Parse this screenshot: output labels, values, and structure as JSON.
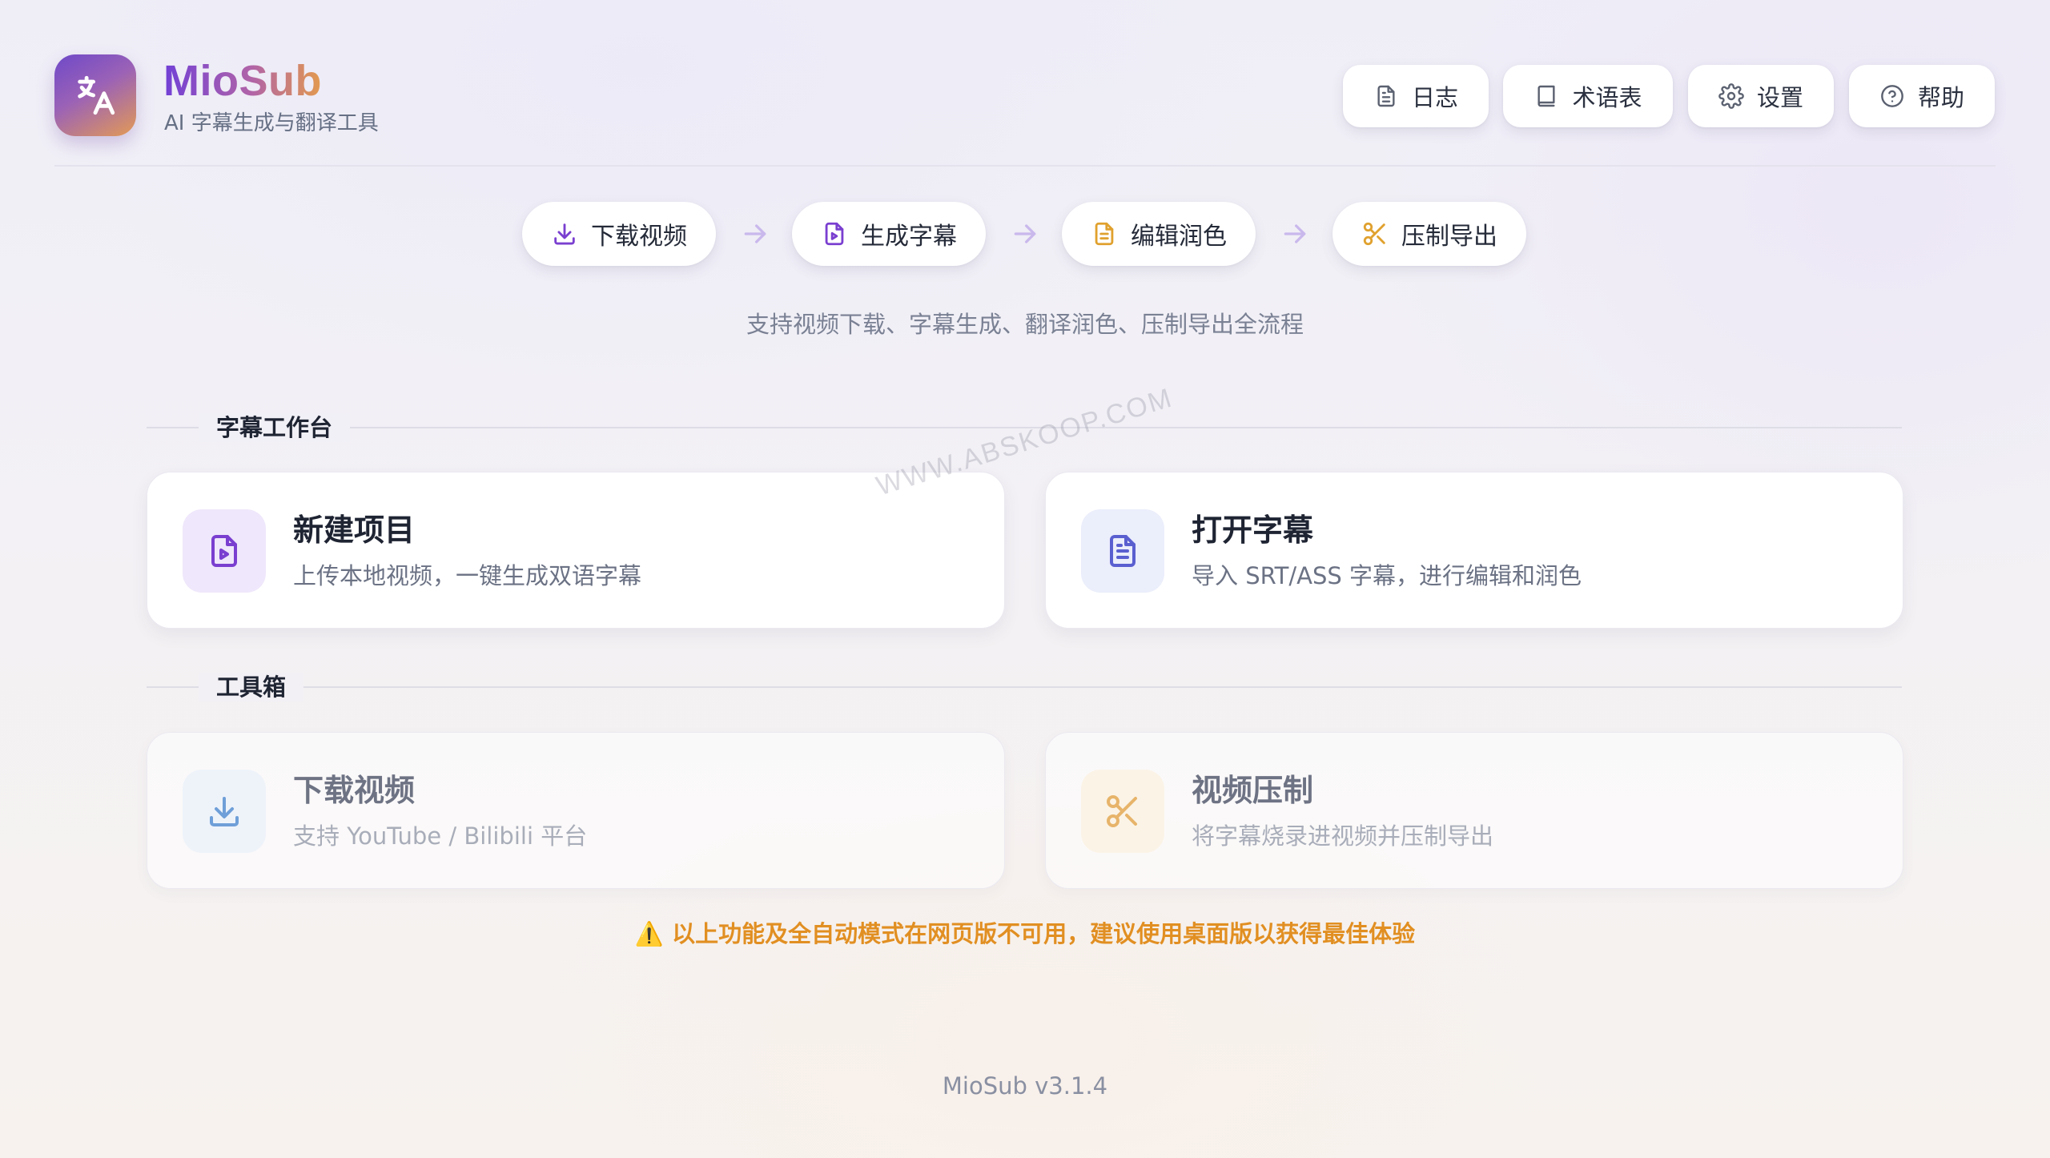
{
  "header": {
    "app_title": "MioSub",
    "app_subtitle": "AI 字幕生成与翻译工具",
    "buttons": [
      {
        "label": "日志",
        "icon": "document-icon"
      },
      {
        "label": "术语表",
        "icon": "book-icon"
      },
      {
        "label": "设置",
        "icon": "gear-icon"
      },
      {
        "label": "帮助",
        "icon": "help-circle-icon"
      }
    ]
  },
  "steps": [
    {
      "label": "下载视频",
      "icon": "download-icon",
      "color": "#7a3fd0"
    },
    {
      "label": "生成字幕",
      "icon": "video-file-icon",
      "color": "#7a3fd0"
    },
    {
      "label": "编辑润色",
      "icon": "text-file-icon",
      "color": "#e0a12e"
    },
    {
      "label": "压制导出",
      "icon": "scissors-icon",
      "color": "#e0a12e"
    }
  ],
  "tagline": "支持视频下载、字幕生成、翻译润色、压制导出全流程",
  "sections": {
    "workbench": {
      "title": "字幕工作台",
      "cards": [
        {
          "title": "新建项目",
          "desc": "上传本地视频，一键生成双语字幕",
          "icon": "video-file-icon"
        },
        {
          "title": "打开字幕",
          "desc": "导入 SRT/ASS 字幕，进行编辑和润色",
          "icon": "text-file-icon"
        }
      ]
    },
    "toolbox": {
      "title": "工具箱",
      "cards": [
        {
          "title": "下载视频",
          "desc": "支持 YouTube / Bilibili 平台",
          "icon": "download-icon"
        },
        {
          "title": "视频压制",
          "desc": "将字幕烧录进视频并压制导出",
          "icon": "scissors-icon"
        }
      ]
    }
  },
  "warning": "以上功能及全自动模式在网页版不可用，建议使用桌面版以获得最佳体验",
  "warning_icon": "⚠️",
  "version": "MioSub v3.1.4",
  "watermark": "WWW.ABSKOOP.COM",
  "colors": {
    "accent_purple": "#7a3fd0",
    "accent_orange": "#e0a12e",
    "warning": "#e18f22"
  }
}
